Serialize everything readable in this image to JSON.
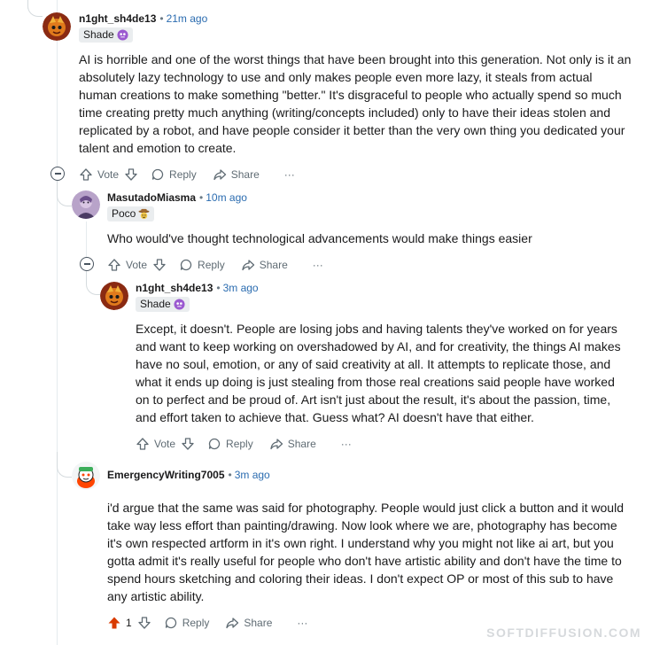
{
  "comments": [
    {
      "username": "n1ght_sh4de13",
      "separator": "•",
      "time": "21m ago",
      "flair": "Shade",
      "body": "AI is horrible and one of the worst things that have been brought into this generation. Not only is it an absolutely lazy technology to use and only makes people even more lazy, it steals from actual human creations to make something \"better.\" It's disgraceful to people who actually spend so much time creating pretty much anything (writing/concepts included) only to have their ideas stolen and replicated by a robot, and have people consider it better than the very own thing you dedicated your talent and emotion to create.",
      "vote_label": "Vote",
      "reply_label": "Reply",
      "share_label": "Share",
      "more_label": "···"
    },
    {
      "username": "MasutadoMiasma",
      "separator": "•",
      "time": "10m ago",
      "flair": "Poco",
      "body": "Who would've thought technological advancements would make things easier",
      "vote_label": "Vote",
      "reply_label": "Reply",
      "share_label": "Share",
      "more_label": "···"
    },
    {
      "username": "n1ght_sh4de13",
      "separator": "•",
      "time": "3m ago",
      "flair": "Shade",
      "body": "Except, it doesn't. People are losing jobs and having talents they've worked on for years and want to keep working on overshadowed by AI, and for creativity, the things AI makes have no soul, emotion, or any of said creativity at all. It attempts to replicate those, and what it ends up doing is just stealing from those real creations said people have worked on to perfect and be proud of. Art isn't just about the result, it's about the passion, time, and effort taken to achieve that. Guess what? AI doesn't have that either.",
      "vote_label": "Vote",
      "reply_label": "Reply",
      "share_label": "Share",
      "more_label": "···"
    },
    {
      "username": "EmergencyWriting7005",
      "separator": "•",
      "time": "3m ago",
      "body": "i'd argue that the same was said for photography. People would just click a button and it would take way less effort than painting/drawing. Now look where we are, photography has become it's own respected artform in it's own right. I understand why you might not like ai art, but you gotta admit it's really useful for people who don't have artistic ability and don't have the time to spend hours sketching and coloring their ideas. I don't expect OP or most of this sub to have any artistic ability.",
      "vote_count": "1",
      "reply_label": "Reply",
      "share_label": "Share",
      "more_label": "···"
    }
  ],
  "watermark": "SOFTDIFFUSION.COM",
  "colors": {
    "accent_upvote": "#d93a00",
    "timestamp": "#2b6cb0",
    "thread_line": "#e5ebee",
    "flair_bg": "#eaedef"
  }
}
